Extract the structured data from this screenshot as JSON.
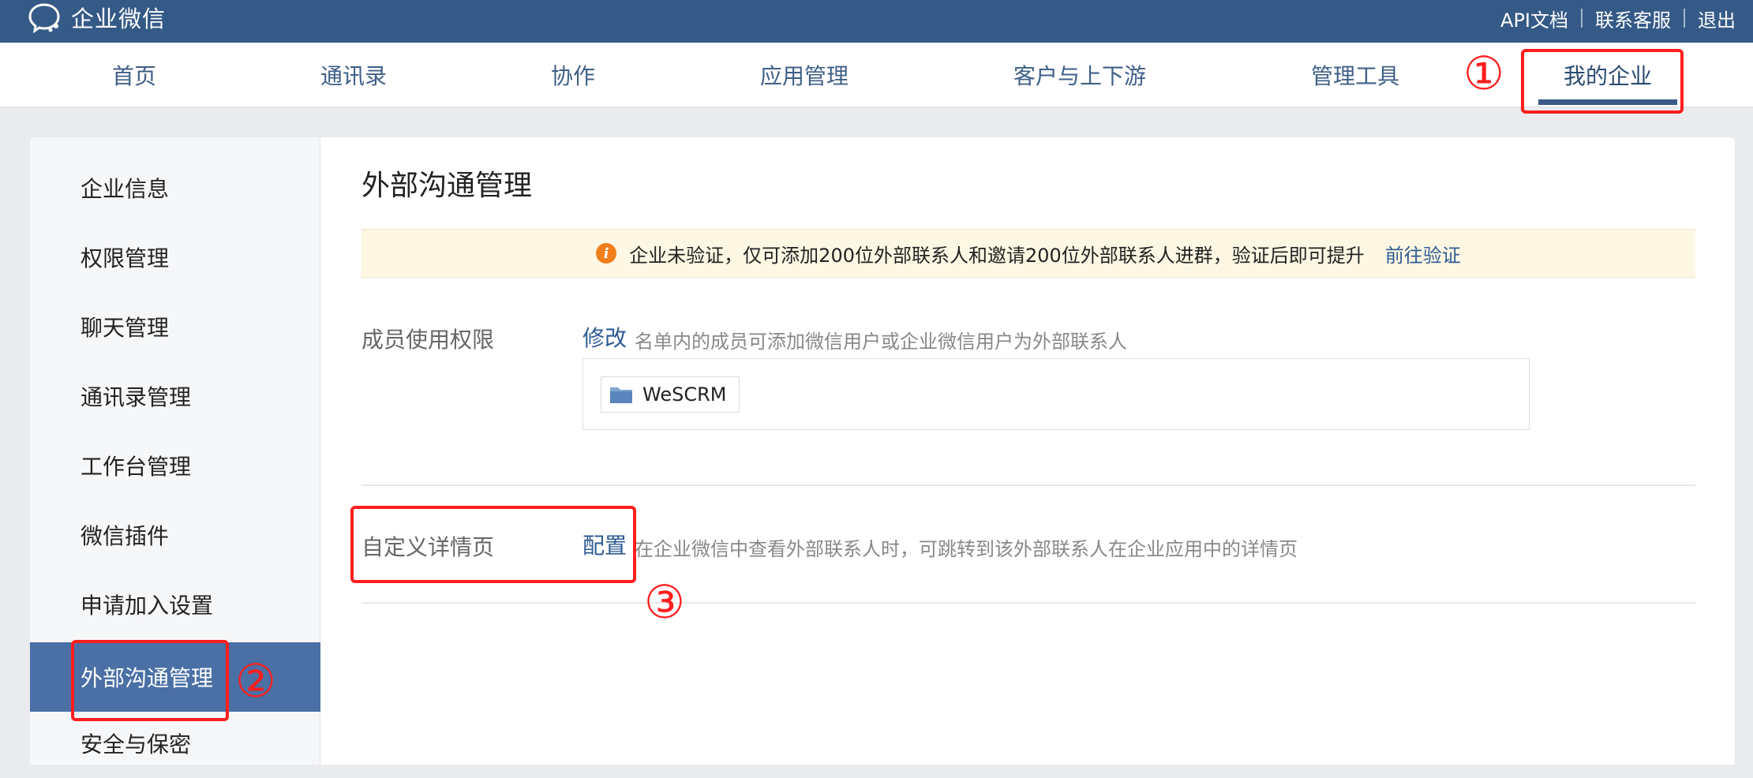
{
  "topbar": {
    "brand_name": "企业微信",
    "links": [
      "API文档",
      "联系客服",
      "退出"
    ]
  },
  "nav": {
    "items": [
      "首页",
      "通讯录",
      "协作",
      "应用管理",
      "客户与上下游",
      "管理工具",
      "我的企业"
    ],
    "active": "我的企业"
  },
  "sidebar": {
    "items": [
      "企业信息",
      "权限管理",
      "聊天管理",
      "通讯录管理",
      "工作台管理",
      "微信插件",
      "申请加入设置",
      "外部沟通管理",
      "安全与保密"
    ],
    "active": "外部沟通管理"
  },
  "main": {
    "title": "外部沟通管理",
    "notice": {
      "icon": "info-icon",
      "text": "企业未验证，仅可添加200位外部联系人和邀请200位外部联系人进群，验证后即可提升",
      "link": "前往验证"
    },
    "member_permission": {
      "label": "成员使用权限",
      "action": "修改",
      "description": "名单内的成员可添加微信用户或企业微信用户为外部联系人",
      "members": [
        {
          "icon": "folder-icon",
          "name": "WeSCRM"
        }
      ]
    },
    "custom_detail": {
      "label": "自定义详情页",
      "action": "配置",
      "description": "在企业微信中查看外部联系人时，可跳转到该外部联系人在企业应用中的详情页"
    }
  },
  "annotations": {
    "step1": "①",
    "step2": "②",
    "step3": "③",
    "color": "#ff1e1e"
  },
  "colors": {
    "topbar": "#355a87",
    "accent": "#4a70a6",
    "link": "#2e5b93",
    "notice_bg": "#fdf7e3",
    "notice_icon": "#f07f1b"
  }
}
